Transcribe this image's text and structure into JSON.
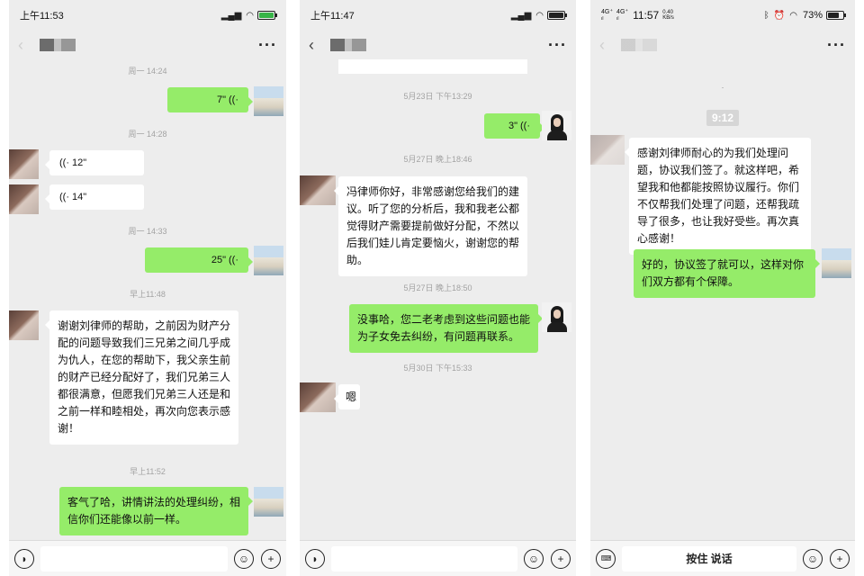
{
  "phone1": {
    "status": {
      "time": "上午11:53"
    },
    "messages": {
      "t1": "周一 14:24",
      "v1": "7\"",
      "t2": "周一 14:28",
      "v2": "12\"",
      "v3": "14\"",
      "t3": "周一 14:33",
      "v4": "25\"",
      "t4": "早上11:48",
      "m1": "谢谢刘律师的帮助，之前因为财产分配的问题导致我们三兄弟之间几乎成为仇人，在您的帮助下，我父亲生前的财产已经分配好了，我们兄弟三人都很满意，但愿我们兄弟三人还是和之前一样和睦相处，再次向您表示感谢！",
      "t5": "早上11:52",
      "m2": "客气了哈，讲情讲法的处理纠纷，相信你们还能像以前一样。"
    }
  },
  "phone2": {
    "status": {
      "time": "上午11:47"
    },
    "messages": {
      "t1": "5月23日 下午13:29",
      "v1": "3\"",
      "t2": "5月27日 晚上18:46",
      "m1": "冯律师你好，非常感谢您给我们的建议。听了您的分析后，我和我老公都觉得财产需要提前做好分配，不然以后我们娃儿肯定要恼火，谢谢您的帮助。",
      "t3": "5月27日 晚上18:50",
      "m2": "没事哈，您二老考虑到这些问题也能为子女免去纠纷，有问题再联系。",
      "t4": "5月30日 下午15:33",
      "m3": "嗯"
    }
  },
  "phone3": {
    "status": {
      "time": "11:57",
      "net1": "4G⁺",
      "net2": "4G⁺",
      "speed_value": "0.40",
      "speed_unit": "KB/s",
      "battery": "73%"
    },
    "messages": {
      "dot": "·",
      "t1": "9:12",
      "m1": "感谢刘律师耐心的为我们处理问题，协议我们签了。就这样吧，希望我和他都能按照协议履行。你们不仅帮我们处理了问题，还帮我疏导了很多，也让我好受些。再次真心感谢！",
      "m2": "好的，协议签了就可以，这样对你们双方都有个保障。"
    },
    "hold_to_talk": "按住 说话"
  },
  "icons": {
    "back": "‹",
    "more": "···",
    "voice_wave": "((·",
    "voice_btn": "voice-icon",
    "emoji": "emoji-icon",
    "plus": "plus-icon",
    "keyboard": "keyboard-icon"
  },
  "colors": {
    "bubble_out": "#95ec69",
    "bubble_in": "#ffffff",
    "bg": "#ededed"
  }
}
